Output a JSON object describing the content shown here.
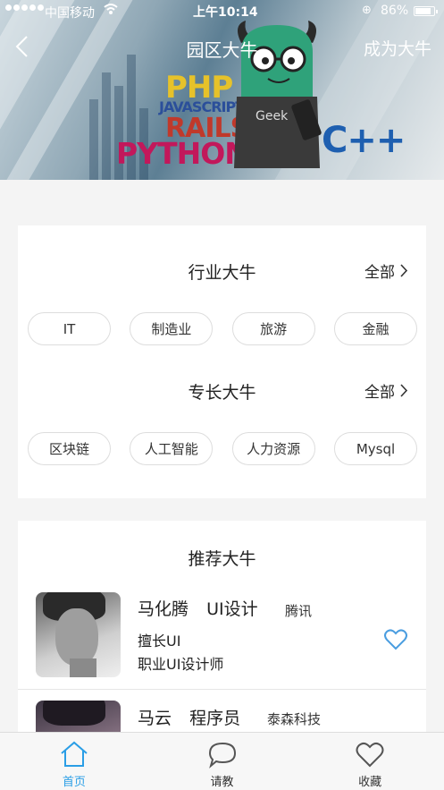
{
  "status_bar": {
    "carrier": "中国移动",
    "time": "上午10:14",
    "battery": "86%"
  },
  "nav": {
    "title": "园区大牛",
    "right_action": "成为大牛"
  },
  "banner": {
    "logo_words": [
      "PHP",
      "JAVASCRIPT",
      "RAILS",
      "PYTHON",
      "C++"
    ],
    "mascot_label": "Geek"
  },
  "industry": {
    "title": "行业大牛",
    "more": "全部",
    "chips": [
      "IT",
      "制造业",
      "旅游",
      "金融"
    ]
  },
  "specialty": {
    "title": "专长大牛",
    "more": "全部",
    "chips": [
      "区块链",
      "人工智能",
      "人力资源",
      "Mysql"
    ]
  },
  "recommended": {
    "title": "推荐大牛",
    "people": [
      {
        "name": "马化腾",
        "role": "UI设计",
        "company": "腾讯",
        "skill": "擅长UI",
        "job": "职业UI设计师"
      },
      {
        "name": "马云",
        "role": "程序员",
        "company": "泰森科技"
      }
    ]
  },
  "tabbar": {
    "items": [
      {
        "label": "首页"
      },
      {
        "label": "请教"
      },
      {
        "label": "收藏"
      }
    ]
  },
  "colors": {
    "accent": "#2a9ee6",
    "heart": "#4a9de0"
  }
}
